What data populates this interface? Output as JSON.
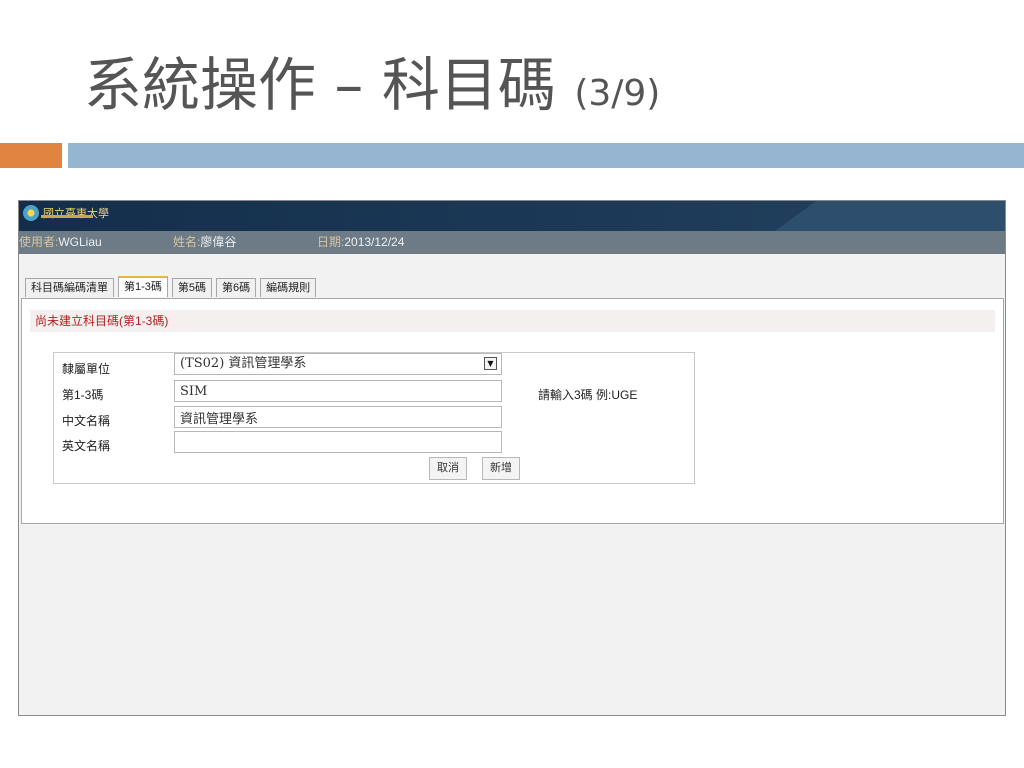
{
  "slide": {
    "title": "系統操作 – 科目碼",
    "subtitle": "(3/9)"
  },
  "app": {
    "logo_text": "國立臺東大學",
    "userbar": {
      "user_label": "使用者:",
      "user_value": "WGLiau",
      "name_label": "姓名:",
      "name_value": "廖偉谷",
      "date_label": "日期:",
      "date_value": "2013/12/24"
    },
    "tabs": [
      {
        "label": "科目碼編碼清單",
        "active": false
      },
      {
        "label": "第1-3碼",
        "active": true
      },
      {
        "label": "第5碼",
        "active": false
      },
      {
        "label": "第6碼",
        "active": false
      },
      {
        "label": "編碼規則",
        "active": false
      }
    ],
    "alert": "尚未建立科目碼(第1-3碼)",
    "form": {
      "unit_label": "隸屬單位",
      "unit_value": "(TS02) 資訊管理學系",
      "code_label": "第1-3碼",
      "code_value": "SIM",
      "code_hint": "請輸入3碼 例:UGE",
      "cname_label": "中文名稱",
      "cname_value": "資訊管理學系",
      "ename_label": "英文名稱",
      "ename_value": "",
      "cancel_label": "取消",
      "add_label": "新增"
    }
  },
  "colors": {
    "accent_orange": "#e0843f",
    "accent_blue": "#96b5d1",
    "header_navy": "#1b3957",
    "alert_red": "#b22222"
  }
}
